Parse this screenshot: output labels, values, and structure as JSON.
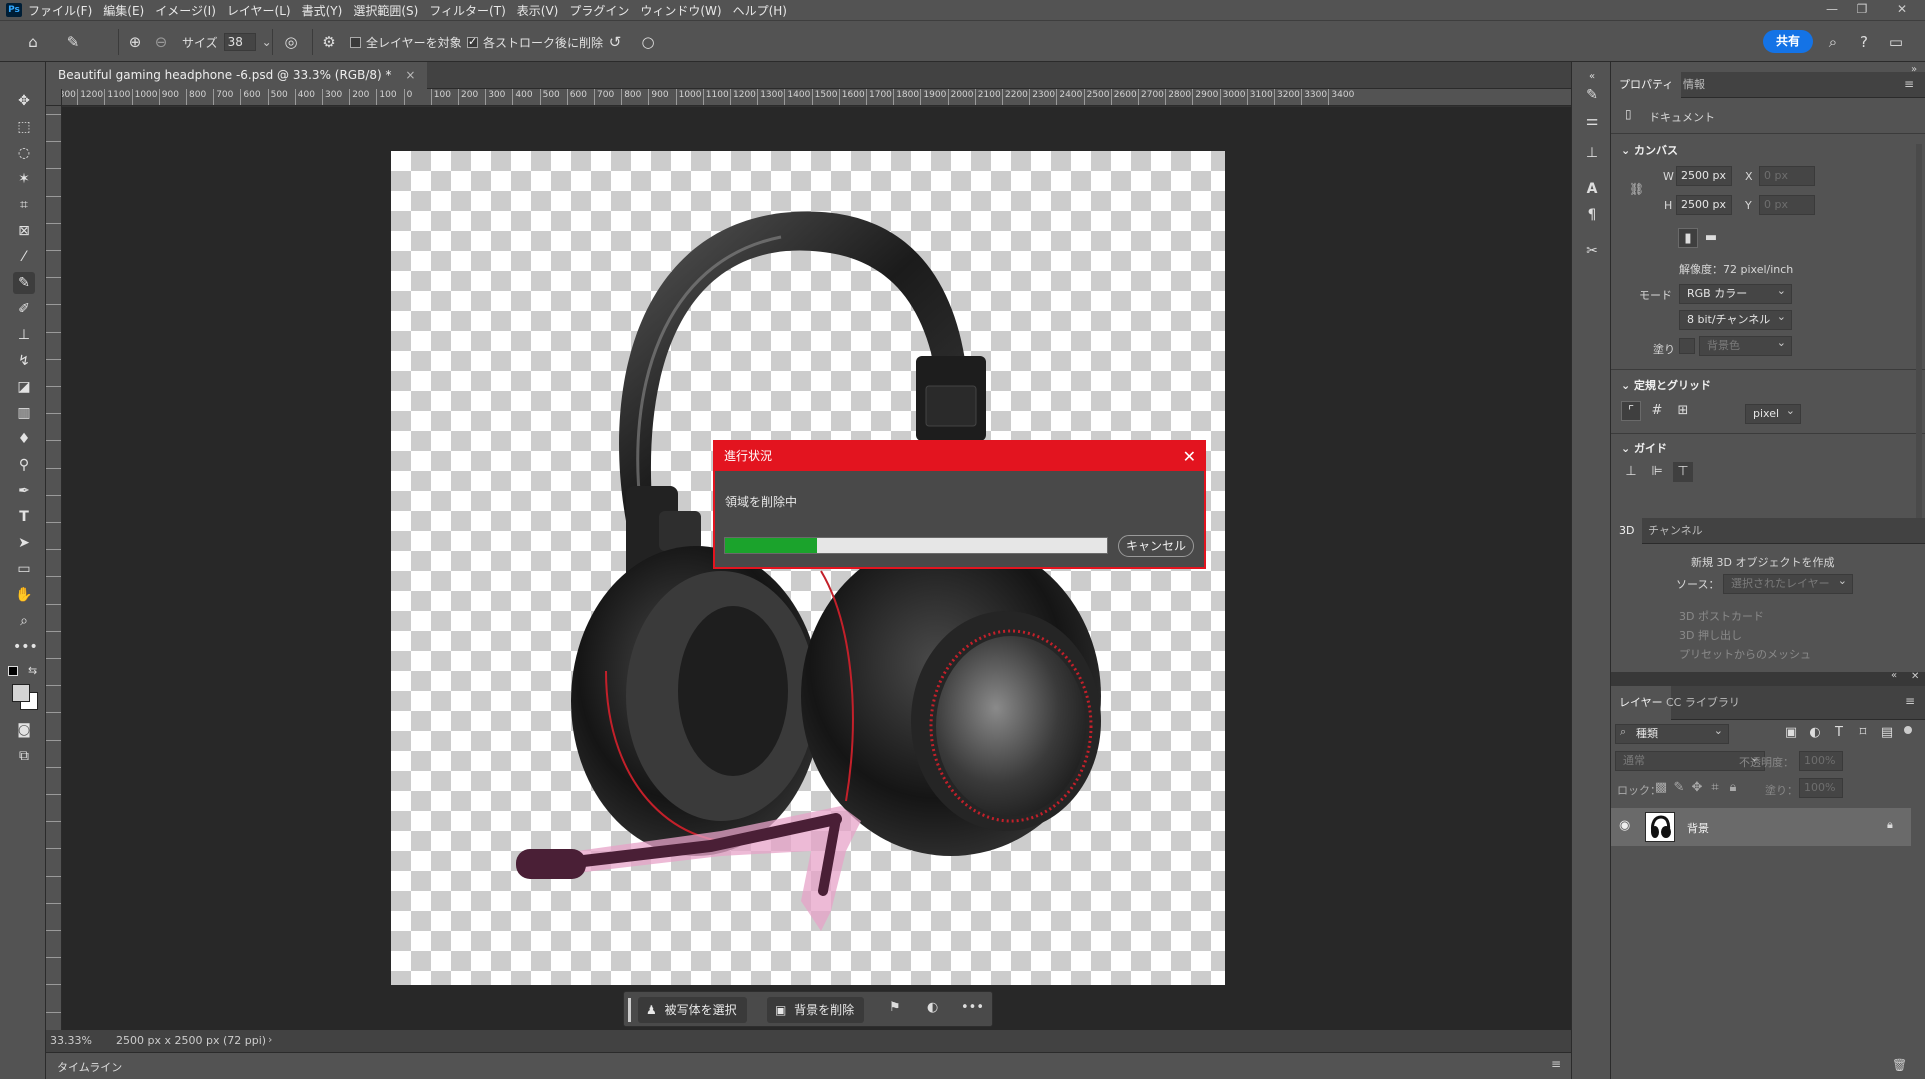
{
  "app": {
    "logo": "Ps",
    "menus": [
      "ファイル(F)",
      "編集(E)",
      "イメージ(I)",
      "レイヤー(L)",
      "書式(Y)",
      "選択範囲(S)",
      "フィルター(T)",
      "表示(V)",
      "プラグイン",
      "ウィンドウ(W)",
      "ヘルプ(H)"
    ],
    "window_controls": [
      "—",
      "❐",
      "✕"
    ]
  },
  "options_bar": {
    "size_label": "サイズ",
    "size_value": "38",
    "sample_all_layers": "全レイヤーを対象",
    "delete_after_stroke": "各ストローク後に削除",
    "sample_all_checked": false,
    "delete_after_checked": true,
    "share_label": "共有"
  },
  "document": {
    "tab_title": "Beautiful gaming headphone -6.psd @ 33.3% (RGB/8) *",
    "tab_close": "×",
    "zoom": "33.33%",
    "doc_info": "2500 px x 2500 px (72 ppi)"
  },
  "ruler": {
    "labels": [
      "1300",
      "1200",
      "1100",
      "1000",
      "900",
      "800",
      "700",
      "600",
      "500",
      "400",
      "300",
      "200",
      "100",
      "0",
      "100",
      "200",
      "300",
      "400",
      "500",
      "600",
      "700",
      "800",
      "900",
      "1000",
      "1100",
      "1200",
      "1300",
      "1400",
      "1500",
      "1600",
      "1700",
      "1800",
      "1900",
      "2000",
      "2100",
      "2200",
      "2300",
      "2400",
      "2500",
      "2600",
      "2700",
      "2800",
      "2900",
      "3000",
      "3100",
      "3200",
      "3300",
      "3400"
    ]
  },
  "task_bar": {
    "select_subject": "被写体を選択",
    "remove_background": "背景を削除",
    "more": "•••"
  },
  "dialog": {
    "title": "進行状況",
    "message": "領域を削除中",
    "cancel": "キャンセル",
    "progress": 0.24,
    "close": "✕"
  },
  "timeline": {
    "label": "タイムライン"
  },
  "properties": {
    "tab_properties": "プロパティ",
    "tab_info": "情報",
    "doc_label": "ドキュメント",
    "canvas_section": "カンバス",
    "w_label": "W",
    "w_value": "2500 px",
    "h_label": "H",
    "h_value": "2500 px",
    "x_label": "X",
    "x_value": "0 px",
    "y_label": "Y",
    "y_value": "0 px",
    "resolution": "解像度：72 pixel/inch",
    "mode_label": "モード",
    "mode_value": "RGB カラー",
    "bit_value": "8 bit/チャンネル",
    "fill_label": "塗り",
    "fill_value": "背景色",
    "rulers_section": "定規とグリッド",
    "unit_value": "pixel",
    "guides_section": "ガイド"
  },
  "three_d": {
    "tab_3d": "3D",
    "tab_channels": "チャンネル",
    "create_label": "新規 3D オブジェクトを作成",
    "source_label": "ソース：",
    "source_value": "選択されたレイヤー",
    "opt1": "3D ポストカード",
    "opt2": "3D 押し出し",
    "opt3": "プリセットからのメッシュ"
  },
  "layers": {
    "tab_layers": "レイヤー",
    "tab_cc": "CC ライブラリ",
    "filter_kind": "種類",
    "blend_mode": "通常",
    "opacity_label": "不透明度：",
    "opacity_value": "100%",
    "lock_label": "ロック：",
    "fill_label": "塗り：",
    "fill_value": "100%",
    "layer_name": "背景"
  },
  "colors": {
    "accent": "#1473e6",
    "dialog_red": "#e3141f",
    "progress_green": "#1ba32c",
    "mask_pink": "#e7a3c8"
  }
}
